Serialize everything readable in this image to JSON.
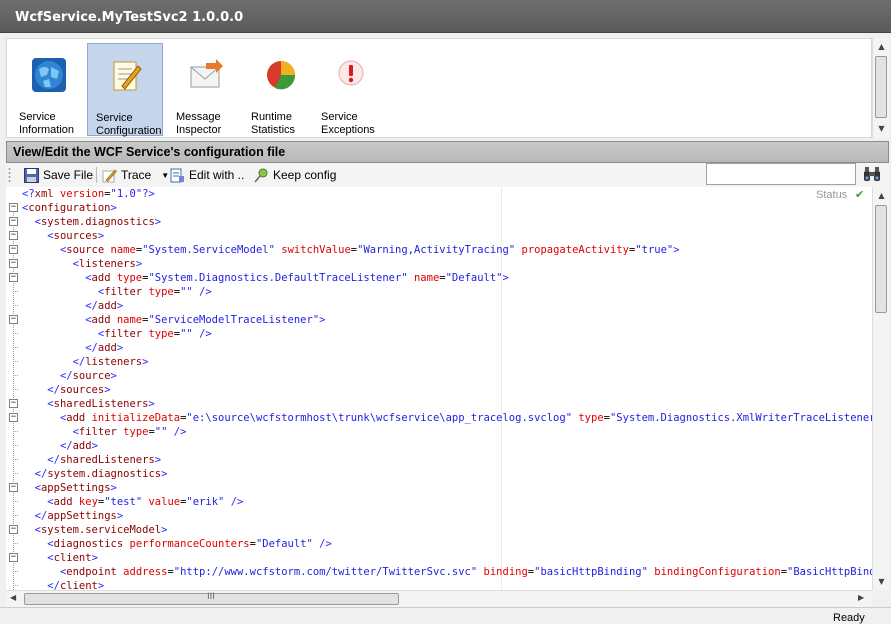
{
  "window": {
    "title": "WcfService.MyTestSvc2 1.0.0.0"
  },
  "ribbon": {
    "buttons": [
      {
        "label": "Service\nInformation",
        "icon": "globe-icon",
        "selected": false
      },
      {
        "label": "Service\nConfiguration",
        "icon": "notepad-pencil-icon",
        "selected": true
      },
      {
        "label": "Message\nInspector",
        "icon": "envelope-arrow-icon",
        "selected": false
      },
      {
        "label": "Runtime\nStatistics",
        "icon": "pie-chart-icon",
        "selected": false
      },
      {
        "label": "Service\nExceptions",
        "icon": "exclamation-icon",
        "selected": false
      }
    ]
  },
  "section": {
    "title": "View/Edit the WCF Service's configuration file"
  },
  "toolbar": {
    "save_label": "Save File",
    "trace_label": "Trace",
    "edit_label": "Edit with ..",
    "keep_label": "Keep config",
    "search_value": ""
  },
  "editor": {
    "status_label": "Status",
    "status_icon": "checkmark-icon",
    "lines": [
      "<?xml version=\"1.0\"?>",
      "<configuration>",
      "  <system.diagnostics>",
      "    <sources>",
      "      <source name=\"System.ServiceModel\" switchValue=\"Warning,ActivityTracing\" propagateActivity=\"true\">",
      "        <listeners>",
      "          <add type=\"System.Diagnostics.DefaultTraceListener\" name=\"Default\">",
      "            <filter type=\"\" />",
      "          </add>",
      "          <add name=\"ServiceModelTraceListener\">",
      "            <filter type=\"\" />",
      "          </add>",
      "        </listeners>",
      "      </source>",
      "    </sources>",
      "    <sharedListeners>",
      "      <add initializeData=\"e:\\source\\wcfstormhost\\trunk\\wcfservice\\app_tracelog.svclog\" type=\"System.Diagnostics.XmlWriterTraceListener, Syste",
      "        <filter type=\"\" />",
      "      </add>",
      "    </sharedListeners>",
      "  </system.diagnostics>",
      "  <appSettings>",
      "    <add key=\"test\" value=\"erik\" />",
      "  </appSettings>",
      "  <system.serviceModel>",
      "    <diagnostics performanceCounters=\"Default\" />",
      "    <client>",
      "      <endpoint address=\"http://www.wcfstorm.com/twitter/TwitterSvc.svc\" binding=\"basicHttpBinding\" bindingConfiguration=\"BasicHttpBinding_ITw",
      "    </client>"
    ]
  },
  "statusbar": {
    "text": "Ready"
  }
}
